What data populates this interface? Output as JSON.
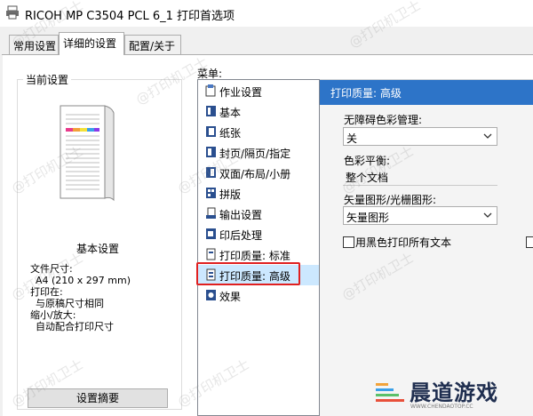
{
  "window": {
    "title": "RICOH MP C3504 PCL 6_1 打印首选项"
  },
  "tabs": [
    {
      "label": "常用设置",
      "active": false
    },
    {
      "label": "详细的设置",
      "active": true
    },
    {
      "label": "配置/关于",
      "active": false
    }
  ],
  "current_settings": {
    "legend": "当前设置",
    "section_title": "基本设置",
    "lines": [
      "文件尺寸:",
      "A4 (210 x 297 mm)",
      "打印在:",
      "与原稿尺寸相同",
      "缩小/放大:",
      "自动配合打印尺寸"
    ],
    "summary_button": "设置摘要"
  },
  "menu": {
    "label": "菜单:",
    "items": [
      {
        "label": "作业设置",
        "icon": "job-settings-icon"
      },
      {
        "label": "基本",
        "icon": "basic-icon"
      },
      {
        "label": "纸张",
        "icon": "paper-icon"
      },
      {
        "label": "封页/隔页/指定",
        "icon": "cover-page-icon"
      },
      {
        "label": "双面/布局/小册",
        "icon": "duplex-layout-icon"
      },
      {
        "label": "拼版",
        "icon": "imposition-icon"
      },
      {
        "label": "输出设置",
        "icon": "output-settings-icon"
      },
      {
        "label": "印后处理",
        "icon": "finishing-icon"
      },
      {
        "label": "打印质量: 标准",
        "icon": "print-quality-standard-icon"
      },
      {
        "label": "打印质量: 高级",
        "icon": "print-quality-advanced-icon",
        "selected": true
      },
      {
        "label": "效果",
        "icon": "effects-icon"
      }
    ]
  },
  "panel": {
    "header": "打印质量: 高级",
    "fields": [
      {
        "label": "无障碍色彩管理:",
        "value": "关"
      },
      {
        "label": "色彩平衡:",
        "value": "整个文档"
      },
      {
        "label": "矢量图形/光栅图形:",
        "value": "矢量图形"
      }
    ],
    "checkbox_label": "用黑色打印所有文本",
    "checkbox_checked": false
  },
  "watermark": {
    "text": "@打印机卫士",
    "logo_text": "晨道游戏",
    "logo_sub": "WWW.CHENDAOTOP.CC"
  },
  "colors": {
    "accent": "#2d74c8",
    "selection": "#cce8ff",
    "highlight": "#e02020"
  }
}
